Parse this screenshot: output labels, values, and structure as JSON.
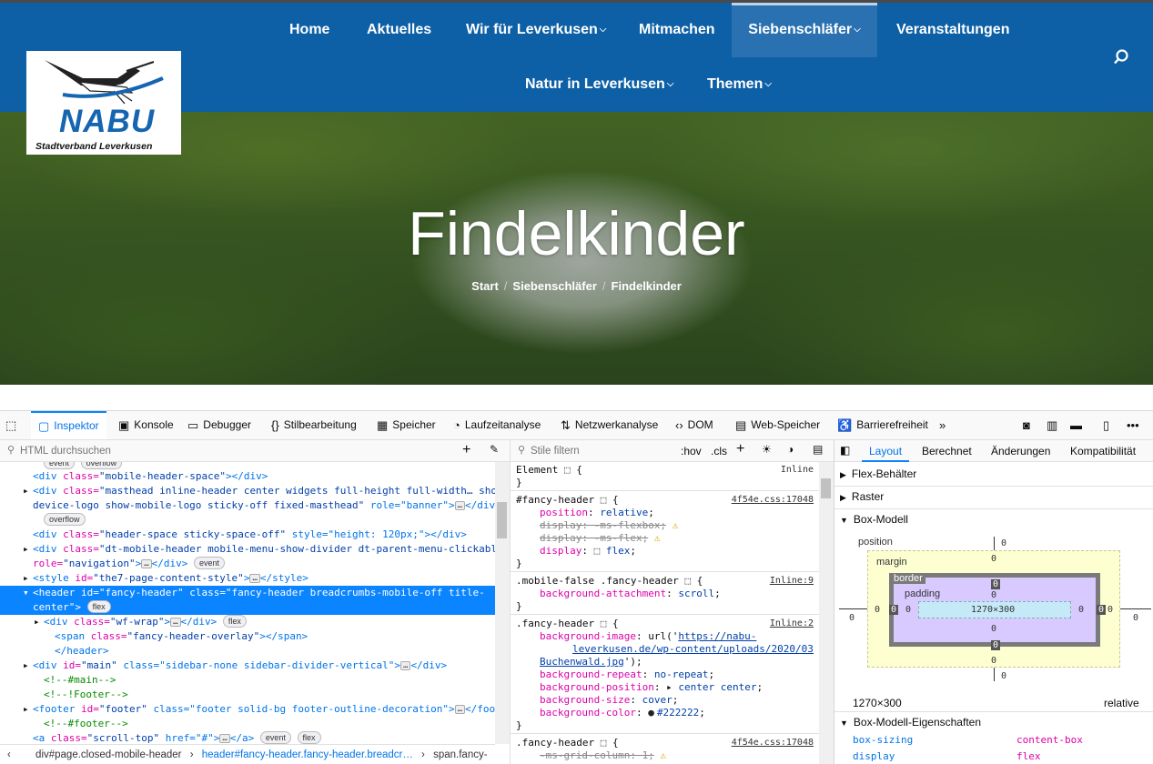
{
  "nav": {
    "items": [
      "Home",
      "Aktuelles",
      "Wir für Leverkusen",
      "Mitmachen",
      "Siebenschläfer",
      "Veranstaltungen",
      "Natur in Leverkusen",
      "Themen"
    ],
    "search_icon": "search-icon"
  },
  "logo": {
    "name": "NABU",
    "subtitle": "Stadtverband Leverkusen"
  },
  "hero": {
    "title": "Findelkinder",
    "breadcrumb": [
      "Start",
      "Siebenschläfer",
      "Findelkinder"
    ],
    "sep": "/"
  },
  "devtools": {
    "tabs": [
      "Inspektor",
      "Konsole",
      "Debugger",
      "Stilbearbeitung",
      "Speicher",
      "Laufzeitanalyse",
      "Netzwerkanalyse",
      "DOM",
      "Web-Speicher",
      "Barrierefreiheit"
    ],
    "search_html": "HTML durchsuchen",
    "filter_styles": "Stile filtern",
    "hov": ":hov",
    "cls": ".cls",
    "html_lines": [
      {
        "pre": "",
        "tag": "",
        "text": "",
        "badges": [
          "event",
          "overflow"
        ]
      },
      {
        "tag": "<div ",
        "attr": "class=",
        "val": "\"mobile-header-space\"",
        "end": "></div>"
      },
      {
        "tag": "<div ",
        "attr": "class=",
        "val": "\"masthead inline-header center widgets full-height full-width… show-",
        "end": ""
      },
      {
        "tag": "",
        "attr": "",
        "val": "device-logo show-mobile-logo sticky-off fixed-masthead\"",
        "end": " role=\"banner\">",
        "extra": "</div>"
      },
      {
        "tag": "",
        "badges": [
          "overflow"
        ]
      },
      {
        "tag": "<div ",
        "attr": "class=",
        "val": "\"header-space sticky-space-off\"",
        "end": " style=\"height: 120px;\"></div>"
      },
      {
        "tag": "<div ",
        "attr": "class=",
        "val": "\"dt-mobile-header mobile-menu-show-divider dt-parent-menu-clickable\"",
        "end": ""
      },
      {
        "tag": "",
        "attr": "role=",
        "val": "\"navigation\"",
        "end": ">",
        "extra": "</div>",
        "badges": [
          "event"
        ]
      },
      {
        "tag": "<style ",
        "attr": "id=",
        "val": "\"the7-page-content-style\"",
        "end": ">",
        "extra": "</style>"
      },
      {
        "tag": "<header ",
        "attr": "id=",
        "val": "\"fancy-header\"",
        "end": " class=\"fancy-header breadcrumbs-mobile-off title-"
      },
      {
        "tag": "",
        "attr": "",
        "val": "center\"",
        "end": ">",
        "badges": [
          "flex"
        ]
      },
      {
        "tag": "<div ",
        "attr": "class=",
        "val": "\"wf-wrap\"",
        "end": ">",
        "extra": "</div>",
        "badges": [
          "flex"
        ]
      },
      {
        "tag": "<span ",
        "attr": "class=",
        "val": "\"fancy-header-overlay\"",
        "end": "></span>"
      },
      {
        "tag": "</header>"
      },
      {
        "tag": "<div ",
        "attr": "id=",
        "val": "\"main\"",
        "end": " class=\"sidebar-none sidebar-divider-vertical\">",
        "extra": "</div>"
      },
      {
        "comment": "<!--#main-->"
      },
      {
        "comment": "<!--!Footer-->"
      },
      {
        "tag": "<footer ",
        "attr": "id=",
        "val": "\"footer\"",
        "end": " class=\"footer solid-bg footer-outline-decoration\">",
        "extra": "</footer>"
      },
      {
        "comment": "<!--#footer-->"
      },
      {
        "tag": "<a ",
        "attr": "class=",
        "val": "\"scroll-top\"",
        "end": " href=\"#\">",
        "extra": "</a>",
        "badges": [
          "event",
          "flex"
        ]
      }
    ],
    "crumbs": [
      "div#page.closed-mobile-header",
      "header#fancy-header.fancy-header.breadcr…",
      "span.fancy-"
    ],
    "rules": [
      {
        "sel": "Element",
        "src": "Inline",
        "props": []
      },
      {
        "sel": "#fancy-header",
        "src": "4f54e.css:17048",
        "props": [
          [
            "position",
            "relative",
            ""
          ],
          [
            "display",
            "-ms-flexbox",
            "strike"
          ],
          [
            "display",
            "-ms-flex",
            "strike"
          ],
          [
            "display",
            "flex",
            ""
          ]
        ]
      },
      {
        "sel": ".mobile-false .fancy-header",
        "src": "Inline:9",
        "props": [
          [
            "background-attachment",
            "scroll",
            ""
          ]
        ]
      },
      {
        "sel": ".fancy-header",
        "src": "Inline:2",
        "props": [
          [
            "background-image",
            "url('https://nabu-leverkusen.de/wp-content/uploads/2020/03/Buchenwald.jpg')",
            ""
          ],
          [
            "background-repeat",
            "no-repeat",
            ""
          ],
          [
            "background-position",
            "center center",
            ""
          ],
          [
            "background-size",
            "cover",
            ""
          ],
          [
            "background-color",
            "#222222",
            ""
          ]
        ]
      },
      {
        "sel": ".fancy-header",
        "src": "4f54e.css:17048",
        "props": [
          [
            "-ms-grid-column",
            "1",
            "strike"
          ]
        ]
      }
    ],
    "layout_tabs": [
      "Layout",
      "Berechnet",
      "Änderungen",
      "Kompatibilität"
    ],
    "sections": [
      "Flex-Behälter",
      "Raster",
      "Box-Modell"
    ],
    "box": {
      "position": "position",
      "margin": "margin",
      "border": "border",
      "padding": "padding",
      "size": "1270×300",
      "zero": "0",
      "footer_size": "1270×300",
      "footer_pos": "relative"
    },
    "boxprops_title": "Box-Modell-Eigenschaften",
    "boxprops": [
      [
        "box-sizing",
        "content-box"
      ],
      [
        "display",
        "flex"
      ]
    ]
  }
}
